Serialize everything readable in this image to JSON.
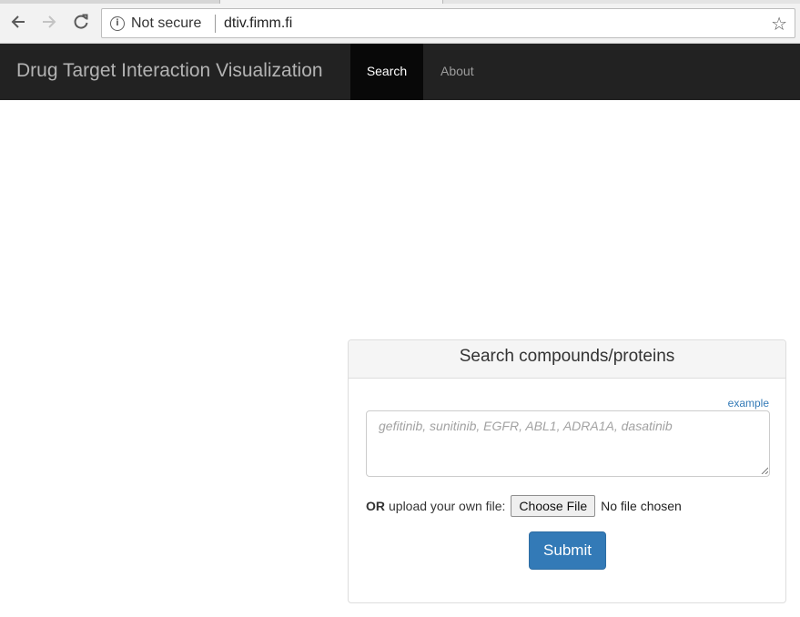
{
  "browser": {
    "security_label": "Not secure",
    "url": "dtiv.fimm.fi",
    "icons": [
      "back-arrow-icon",
      "forward-arrow-icon",
      "reload-icon",
      "info-icon",
      "star-icon"
    ]
  },
  "navbar": {
    "brand": "Drug Target Interaction Visualization",
    "items": [
      {
        "label": "Search",
        "active": true
      },
      {
        "label": "About",
        "active": false
      }
    ],
    "background": "#222222"
  },
  "search_panel": {
    "heading": "Search compounds/proteins",
    "example_link": "example",
    "query_placeholder": "gefitinib, sunitinib, EGFR, ABL1, ADRA1A, dasatinib",
    "query_value": "",
    "upload": {
      "or_label": "OR",
      "label": "upload your own file:",
      "button_label": "Choose File",
      "status": "No file chosen"
    },
    "submit_label": "Submit",
    "submit_color": "#337ab7",
    "link_color": "#337ab7"
  }
}
